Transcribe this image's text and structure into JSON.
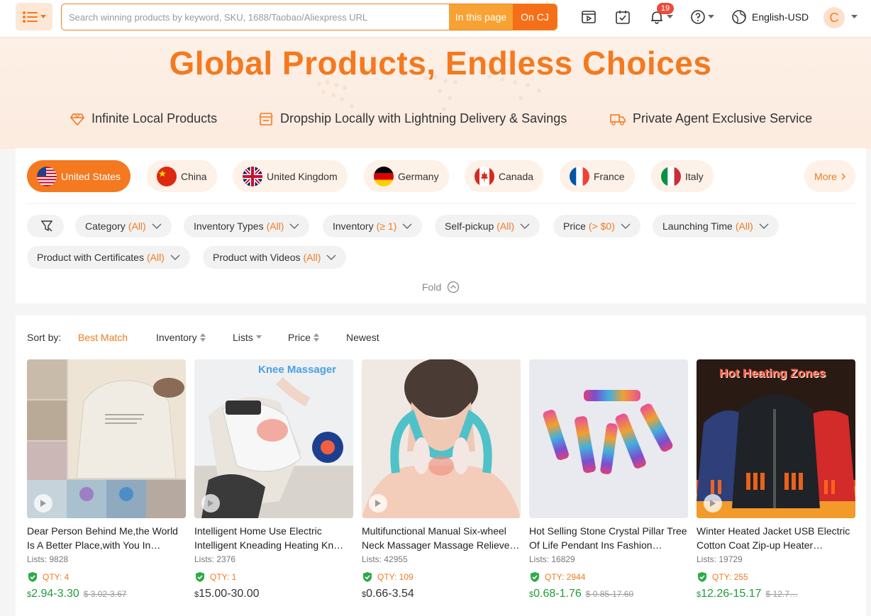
{
  "topbar": {
    "search_placeholder": "Search winning products by keyword, SKU, 1688/Taobao/Aliexpress URL",
    "btn_this_page": "In this page",
    "btn_on_cj": "On CJ",
    "notification_count": "19",
    "language": "English-USD",
    "avatar_letter": "C"
  },
  "hero": {
    "title": "Global Products, Endless Choices",
    "features": [
      {
        "label": "Infinite Local Products",
        "icon": "diamond-icon"
      },
      {
        "label": "Dropship Locally with Lightning Delivery & Savings",
        "icon": "store-icon"
      },
      {
        "label": "Private Agent Exclusive Service",
        "icon": "truck-icon"
      }
    ]
  },
  "countries": [
    {
      "label": "United States",
      "active": true
    },
    {
      "label": "China"
    },
    {
      "label": "United Kingdom"
    },
    {
      "label": "Germany"
    },
    {
      "label": "Canada"
    },
    {
      "label": "France"
    },
    {
      "label": "Italy"
    }
  ],
  "more_label": "More",
  "filters": [
    {
      "label": "Category",
      "value": "(All)"
    },
    {
      "label": "Inventory Types",
      "value": "(All)"
    },
    {
      "label": "Inventory",
      "value": "(≥ 1)"
    },
    {
      "label": "Self-pickup",
      "value": "(All)"
    },
    {
      "label": "Price",
      "value": "(> $0)"
    },
    {
      "label": "Launching Time",
      "value": "(All)"
    },
    {
      "label": "Product with Certificates",
      "value": "(All)"
    },
    {
      "label": "Product with Videos",
      "value": "(All)"
    }
  ],
  "fold_label": "Fold",
  "sort": {
    "label": "Sort by:",
    "options": [
      "Best Match",
      "Inventory",
      "Lists",
      "Price",
      "Newest"
    ]
  },
  "products": [
    {
      "title": "Dear Person Behind Me,the World Is A Better Place,with You In…",
      "lists": "Lists: 9828",
      "qty": "QTY: 4",
      "price": "2.94-3.30",
      "old": "$ 3.02-3.67",
      "currency": "$"
    },
    {
      "title": "Intelligent Home Use Electric Intelligent Kneading Heating Kn…",
      "lists": "Lists: 2376",
      "qty": "QTY: 1",
      "price": "15.00-30.00",
      "old": "",
      "currency": "$"
    },
    {
      "title": "Multifunctional Manual Six-wheel Neck Massager Massage Relieve…",
      "lists": "Lists: 42955",
      "qty": "QTY: 109",
      "price": "0.66-3.54",
      "old": "",
      "currency": "$"
    },
    {
      "title": "Hot Selling Stone Crystal Pillar Tree Of Life Pendant Ins Fashion…",
      "lists": "Lists: 16829",
      "qty": "QTY: 2944",
      "price": "0.68-1.76",
      "old": "$ 0.85-17.60",
      "currency": "$"
    },
    {
      "title": "Winter Heated Jacket USB Electric Cotton Coat Zip-up Heater…",
      "lists": "Lists: 19729",
      "qty": "QTY: 255",
      "price": "12.26-15.17",
      "old": "$ 12.7…",
      "currency": "$"
    }
  ],
  "image_captions": {
    "knee": "Knee Massager",
    "jacket": "Hot Heating Zones"
  },
  "colors": {
    "accent": "#f4791f",
    "green": "#1f9d3a"
  }
}
